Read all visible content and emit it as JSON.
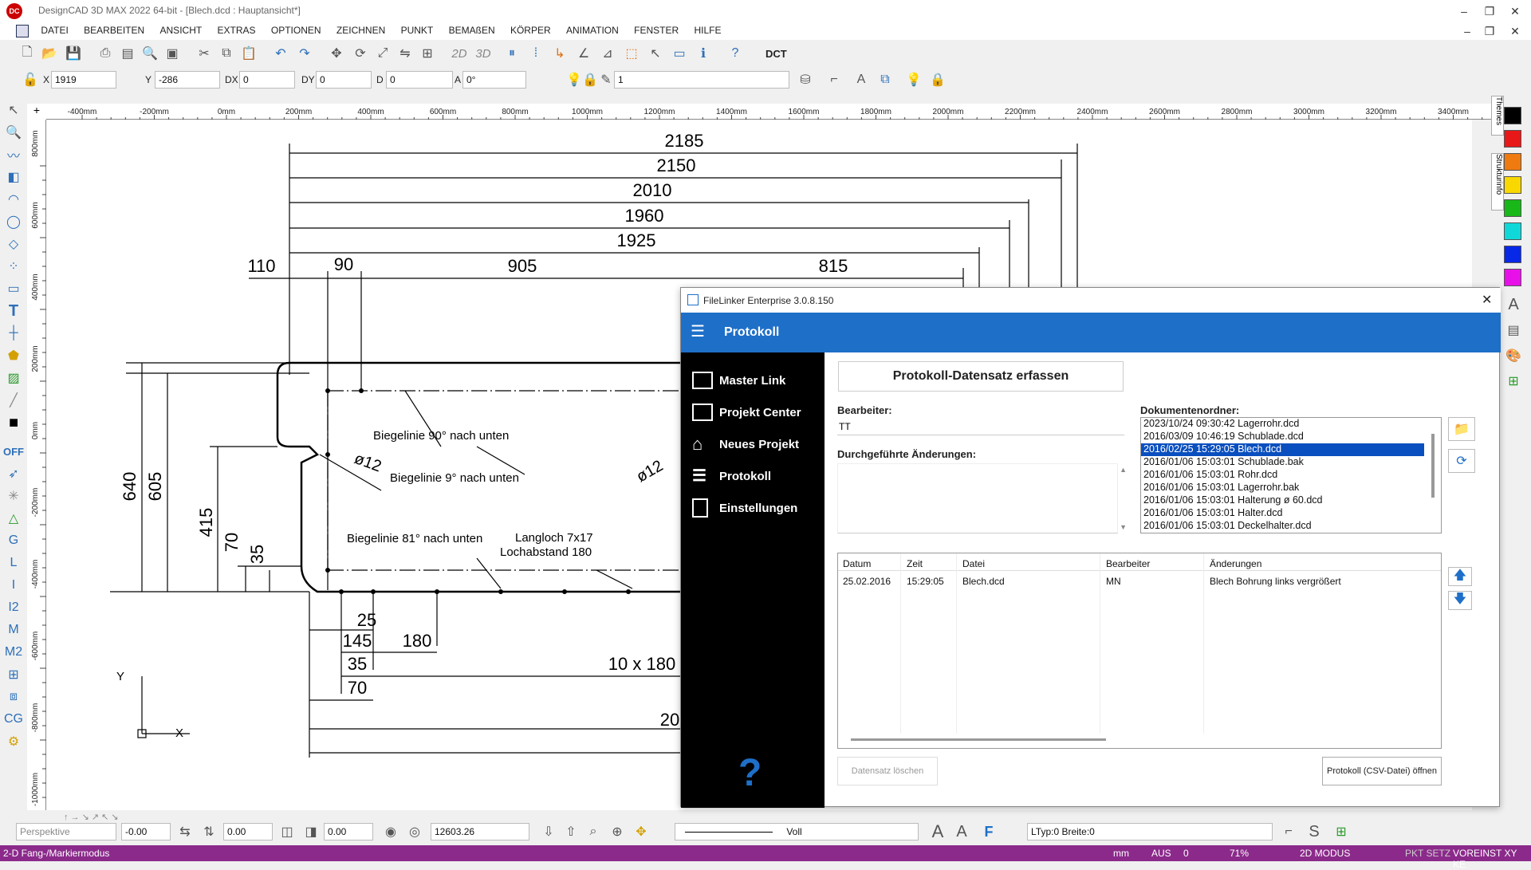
{
  "window": {
    "title": "DesignCAD 3D MAX 2022 64-bit - [Blech.dcd : Hauptansicht*]",
    "logo": "DC"
  },
  "menu": [
    "DATEI",
    "BEARBEITEN",
    "ANSICHT",
    "EXTRAS",
    "OPTIONEN",
    "ZEICHNEN",
    "PUNKT",
    "BEMAßEN",
    "KÖRPER",
    "ANIMATION",
    "FENSTER",
    "HILFE"
  ],
  "toolbar": {
    "dct_label": "DCT",
    "mode2d": "2D",
    "mode3d": "3D"
  },
  "coords": {
    "x_label": "X",
    "x": "1919",
    "y_label": "Y",
    "y": "-286",
    "dx_label": "DX",
    "dx": "0",
    "dy_label": "DY",
    "dy": "0",
    "d_label": "D",
    "d": "0",
    "a_label": "A",
    "a": "0°",
    "layer": "1"
  },
  "ruler_top": [
    "-400mm",
    "-200mm",
    "0mm",
    "200mm",
    "400mm",
    "600mm",
    "800mm",
    "1000mm",
    "1200mm",
    "1400mm",
    "1600mm",
    "1800mm",
    "2000mm",
    "2200mm",
    "2400mm",
    "2600mm",
    "2800mm",
    "3000mm",
    "3200mm",
    "3400mm"
  ],
  "ruler_left": [
    "800mm",
    "600mm",
    "400mm",
    "200mm",
    "0mm",
    "-200mm",
    "-400mm",
    "-600mm",
    "-800mm",
    "-1000mm"
  ],
  "right_tabs": {
    "themes": "Themes",
    "struktur": "Strukturinfo"
  },
  "colors": [
    "#000000",
    "#e81818",
    "#ee7a10",
    "#f8d800",
    "#18b818",
    "#10d8d8",
    "#0828e8",
    "#e810e8"
  ],
  "drawing": {
    "dims_horizontal": [
      "2185",
      "2150",
      "2010",
      "1960",
      "1925",
      "110",
      "90",
      "905",
      "815",
      "25",
      "145",
      "180",
      "35",
      "10 x 180",
      "70",
      "20"
    ],
    "dims_vertical": [
      "640",
      "605",
      "415",
      "70",
      "35"
    ],
    "annotations": [
      "Biegelinie 90° nach unten",
      "ø12",
      "Biegelinie 9° nach unten",
      "ø12",
      "Biegelinie 81° nach unten",
      "Langloch 7x17",
      "Lochabstand 180"
    ],
    "axis_y": "Y",
    "axis_x": "X"
  },
  "bottom": {
    "view": "Perspektive",
    "v1": "-0.00",
    "v2": "0.00",
    "v3": "0.00",
    "v4": "12603.26",
    "line": "Voll",
    "ltyp": "LTyp:0  Breite:0"
  },
  "status": {
    "mode": "2-D Fang-/Markiermodus",
    "unit": "mm",
    "aus": "AUS",
    "zero": "0",
    "zoom": "71%",
    "modus": "2D MODUS",
    "pkt": "PKT SETZ",
    "voreinst": "VOREINST XY KE"
  },
  "dialog": {
    "title": "FileLinker Enterprise 3.0.8.150",
    "header": "Protokoll",
    "nav": [
      "Master Link",
      "Projekt Center",
      "Neues Projekt",
      "Protokoll",
      "Einstellungen"
    ],
    "help": "?",
    "form_title": "Protokoll-Datensatz erfassen",
    "bearbeiter_label": "Bearbeiter:",
    "bearbeiter_value": "TT",
    "aenderungen_label": "Durchgeführte Änderungen:",
    "ordner_label": "Dokumentenordner:",
    "files": [
      "2023/10/24 09:30:42 Lagerrohr.dcd",
      "2016/03/09 10:46:19 Schublade.dcd",
      "2016/02/25 15:29:05 Blech.dcd",
      "2016/01/06 15:03:01 Schublade.bak",
      "2016/01/06 15:03:01 Rohr.dcd",
      "2016/01/06 15:03:01 Lagerrohr.bak",
      "2016/01/06 15:03:01 Halterung ø 60.dcd",
      "2016/01/06 15:03:01 Halter.dcd",
      "2016/01/06 15:03:01 Deckelhalter.dcd"
    ],
    "selected_file_index": 2,
    "table_headers": [
      "Datum",
      "Zeit",
      "Datei",
      "Bearbeiter",
      "Änderungen"
    ],
    "table_rows": [
      [
        "25.02.2016",
        "15:29:05",
        "Blech.dcd",
        "MN",
        "Blech Bohrung links vergrößert"
      ]
    ],
    "btn_delete": "Datensatz löschen",
    "btn_open": "Protokoll (CSV-Datei) öffnen"
  }
}
